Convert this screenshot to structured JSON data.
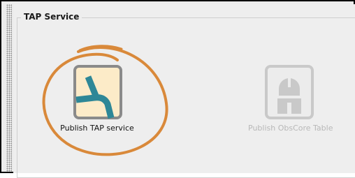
{
  "group": {
    "title": "TAP Service"
  },
  "tools": [
    {
      "label": "Publish TAP service",
      "icon": "branch-icon",
      "enabled": true
    },
    {
      "label": "Publish ObsCore Table",
      "icon": "observatory-icon",
      "enabled": false
    }
  ],
  "colors": {
    "icon_fill": "#fcebc8",
    "icon_border": "#8a8a8a",
    "branch_teal": "#2e8797",
    "annotation_orange": "#d9893a",
    "disabled_gray": "#c9c9c9"
  }
}
